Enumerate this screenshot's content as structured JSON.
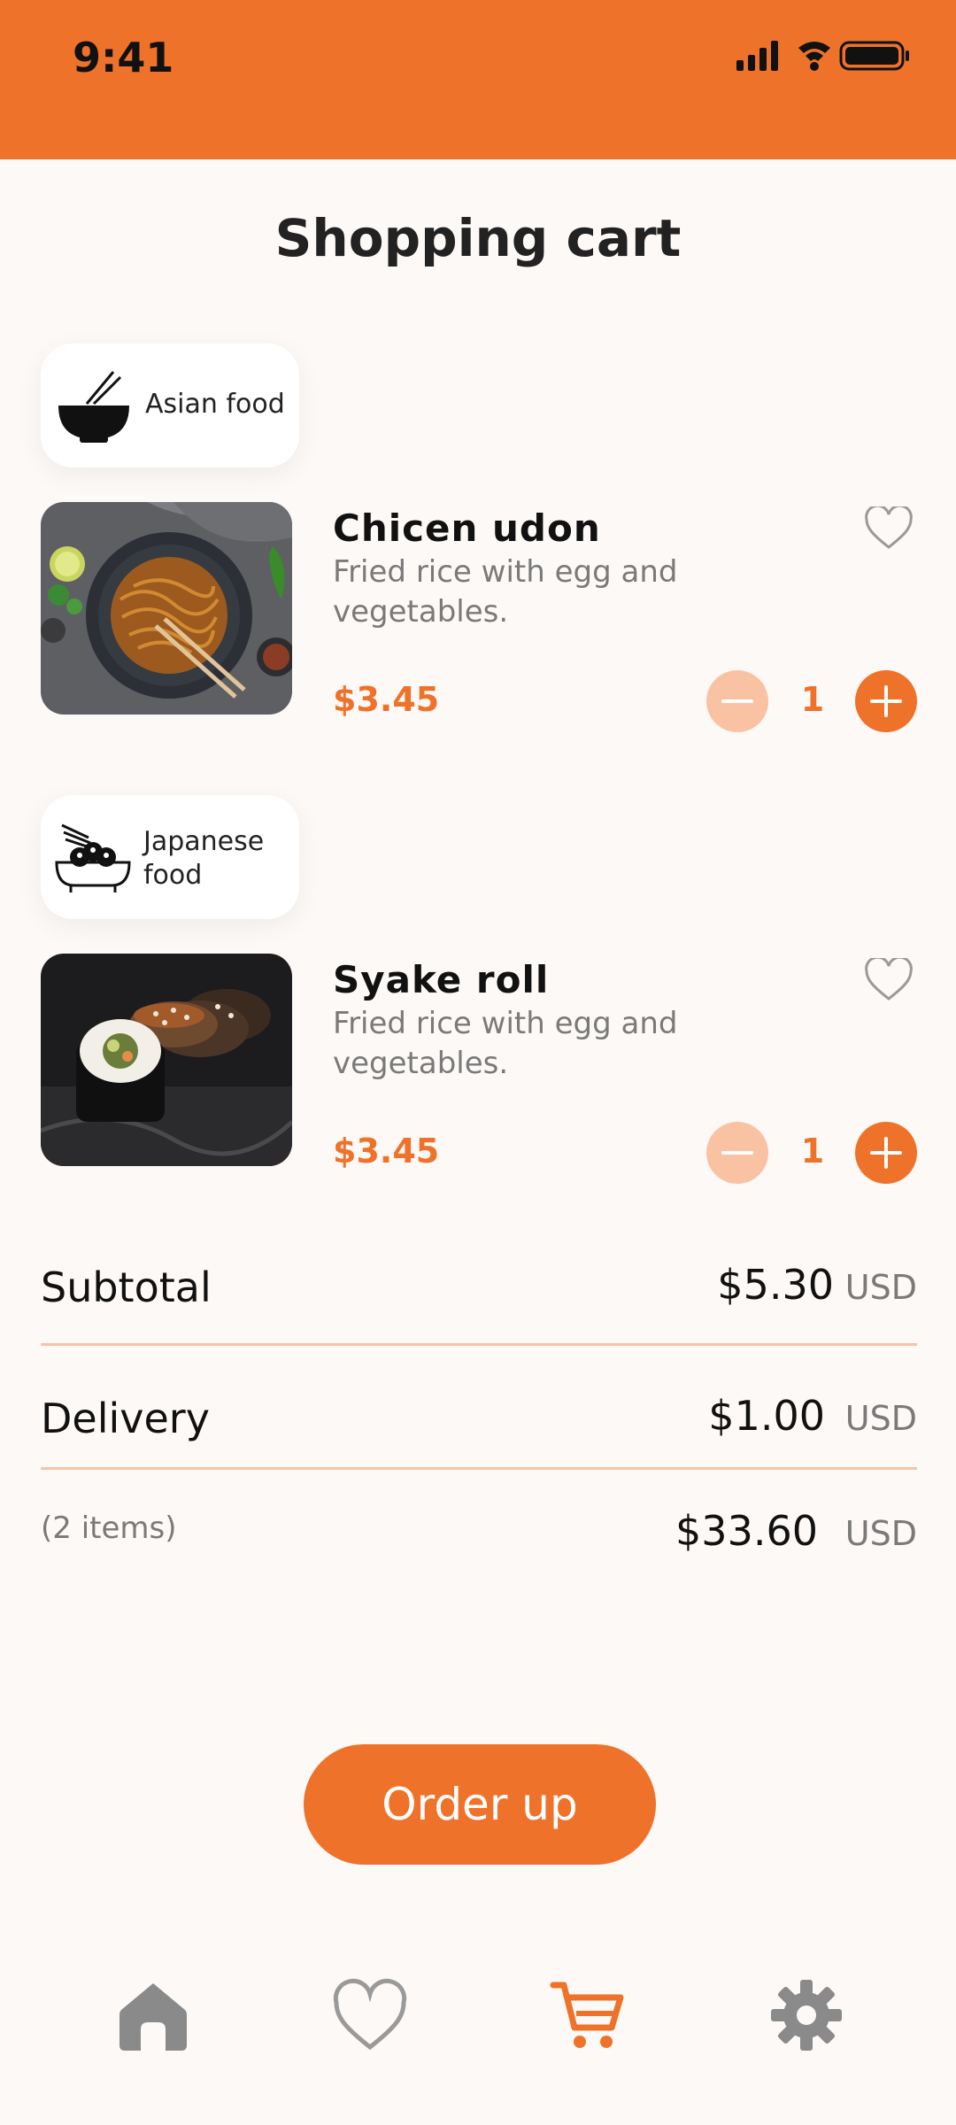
{
  "status_bar": {
    "time": "9:41"
  },
  "page": {
    "title": "Shopping cart"
  },
  "cart": [
    {
      "category": {
        "line1": "Asian food",
        "line2": "",
        "icon": "bowl-chopsticks-icon"
      },
      "name": "Chicen udon",
      "description": "Fried rice with egg and vegetables.",
      "price": "$3.45",
      "quantity": "1"
    },
    {
      "category": {
        "line1": "Japanese",
        "line2": "food",
        "icon": "sushi-bowl-icon"
      },
      "name": "Syake roll",
      "description": "Fried rice with egg and vegetables.",
      "price": "$3.45",
      "quantity": "1"
    }
  ],
  "summary": {
    "subtotal_label": "Subtotal",
    "subtotal_value": "$5.30",
    "subtotal_unit": "USD",
    "delivery_label": "Delivery",
    "delivery_value": "$1.00",
    "delivery_unit": "USD",
    "items_label": "(2 items)",
    "total_value": "$33.60",
    "total_unit": "USD"
  },
  "order_button": {
    "label": "Order up"
  },
  "colors": {
    "accent": "#ef722b",
    "accent_light": "#f9c3a3",
    "background": "#fdf9f6"
  },
  "nav": [
    {
      "icon": "home-icon",
      "active": false
    },
    {
      "icon": "heart-icon",
      "active": false
    },
    {
      "icon": "cart-icon",
      "active": true
    },
    {
      "icon": "gear-icon",
      "active": false
    }
  ]
}
